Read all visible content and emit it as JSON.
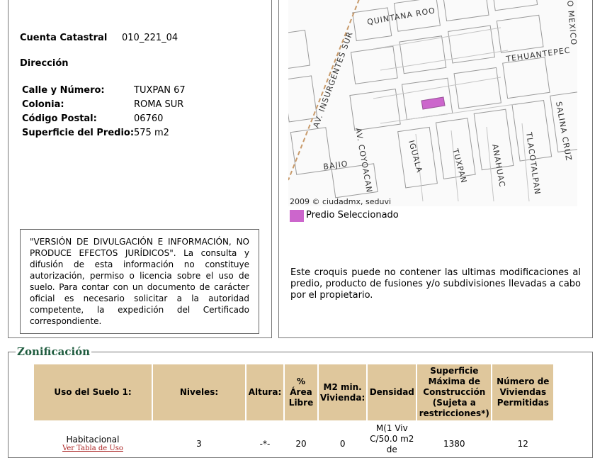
{
  "predio": {
    "cuenta_label": "Cuenta Catastral",
    "cuenta_value": "010_221_04",
    "direccion_label": "Dirección",
    "fields": [
      {
        "label": "Calle y Número:",
        "value": "TUXPAN 67"
      },
      {
        "label": "Colonia:",
        "value": "ROMA SUR"
      },
      {
        "label": "Código Postal:",
        "value": "06760"
      },
      {
        "label": "Superficie del Predio:",
        "value": "575 m2"
      }
    ],
    "notice": "\"VERSIÓN DE DIVULGACIÓN E INFORMACIÓN, NO PRODUCE EFECTOS JURÍDICOS\". La consulta y difusión de esta información no constituye autorización, permiso o licencia sobre el uso de suelo. Para contar con un documento de carácter oficial es necesario solicitar a la autoridad competente, la expedición del Certificado correspondiente."
  },
  "map": {
    "streets": [
      "QUINTANA ROO",
      "TEHUANTEPEC",
      "AV. INSURGENTES SUR",
      "AV. COYOACAN",
      "BAJIO",
      "IGUALA",
      "TUXPAN",
      "ANAHUAC",
      "TLACOTALPAN",
      "SALINA CRUZ",
      "O MEXICO"
    ],
    "credit": "2009 © ciudadmx, seduvi",
    "legend_label": "Predio Seleccionado",
    "legend_color": "#cc66cc",
    "croquis_note": "Este croquis puede no contener las ultimas modificaciones al predio, producto de fusiones y/o subdivisiones llevadas a cabo por el propietario."
  },
  "zonificacion": {
    "title": "Zonificación",
    "headers": [
      "Uso del Suelo 1:",
      "Niveles:",
      "Altura:",
      "% Área Libre",
      "M2 min. Vivienda:",
      "Densidad",
      "Superficie Máxima de Construcción (Sujeta a restricciones*)",
      "Número de Viviendas Permitidas"
    ],
    "row": {
      "uso": "Habitacional",
      "uso_link": "Ver Tabla de Uso",
      "niveles": "3",
      "altura": "-*-",
      "area_libre": "20",
      "m2_min": "0",
      "densidad": "M(1 Viv C/50.0 m2 de",
      "superficie": "1380",
      "viviendas": "12"
    },
    "header_color": "#dfc79c"
  }
}
